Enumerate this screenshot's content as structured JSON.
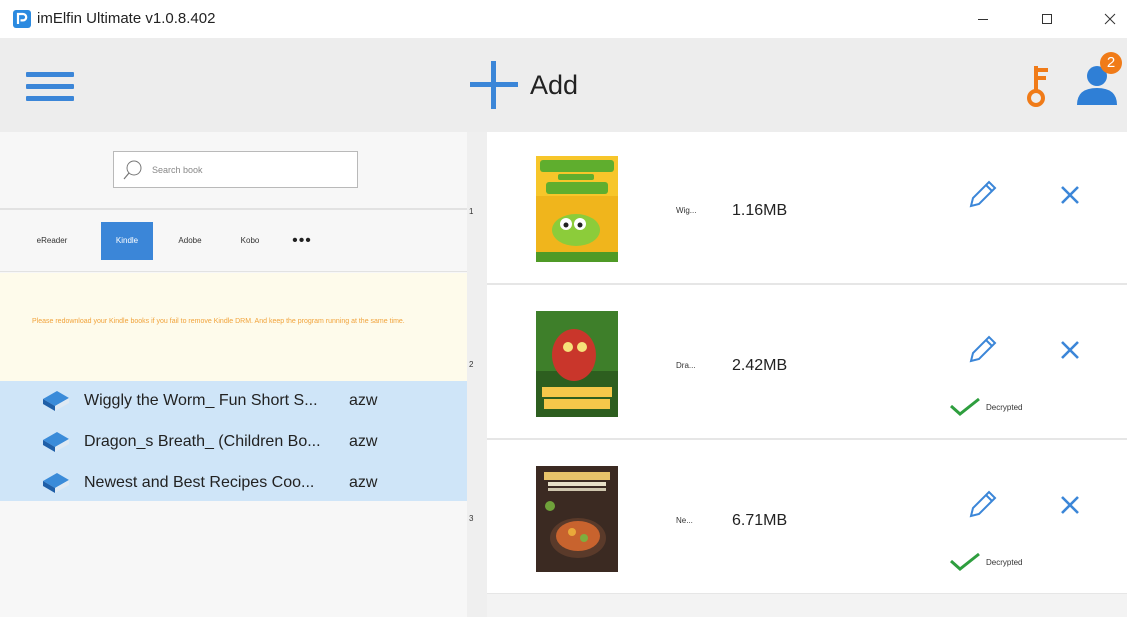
{
  "window": {
    "title": "imElfin Ultimate v1.0.8.402",
    "controls": {
      "minimize": "minimize-icon",
      "maximize": "maximize-icon",
      "close": "close-icon"
    }
  },
  "toolbar": {
    "menu_icon": "hamburger-menu-icon",
    "add_label": "Add",
    "key_icon": "key-icon",
    "user_icon": "user-icon",
    "user_badge": "2"
  },
  "left": {
    "search_placeholder": "Search book",
    "tabs": [
      {
        "label": "eReader",
        "active": false
      },
      {
        "label": "Kindle",
        "active": true
      },
      {
        "label": "Adobe",
        "active": false
      },
      {
        "label": "Kobo",
        "active": false
      }
    ],
    "more_label": "•••",
    "notice": "Please redownload your Kindle books if you fail to remove Kindle DRM. And keep the program running at the same time.",
    "books": [
      {
        "title": "Wiggly the Worm_ Fun Short S...",
        "format": "azw"
      },
      {
        "title": "Dragon_s Breath_ (Children Bo...",
        "format": "azw"
      },
      {
        "title": "Newest and Best Recipes Coo...",
        "format": "azw"
      }
    ]
  },
  "right": {
    "items": [
      {
        "index": "1",
        "name": "Wig...",
        "size": "1.16MB",
        "status": ""
      },
      {
        "index": "2",
        "name": "Dra...",
        "size": "2.42MB",
        "status": "Decrypted"
      },
      {
        "index": "3",
        "name": "Ne...",
        "size": "6.71MB",
        "status": "Decrypted"
      }
    ]
  },
  "colors": {
    "accent": "#3b86d8",
    "orange": "#f07b18",
    "success": "#2e9e3e",
    "notice_text": "#f1a33b"
  }
}
